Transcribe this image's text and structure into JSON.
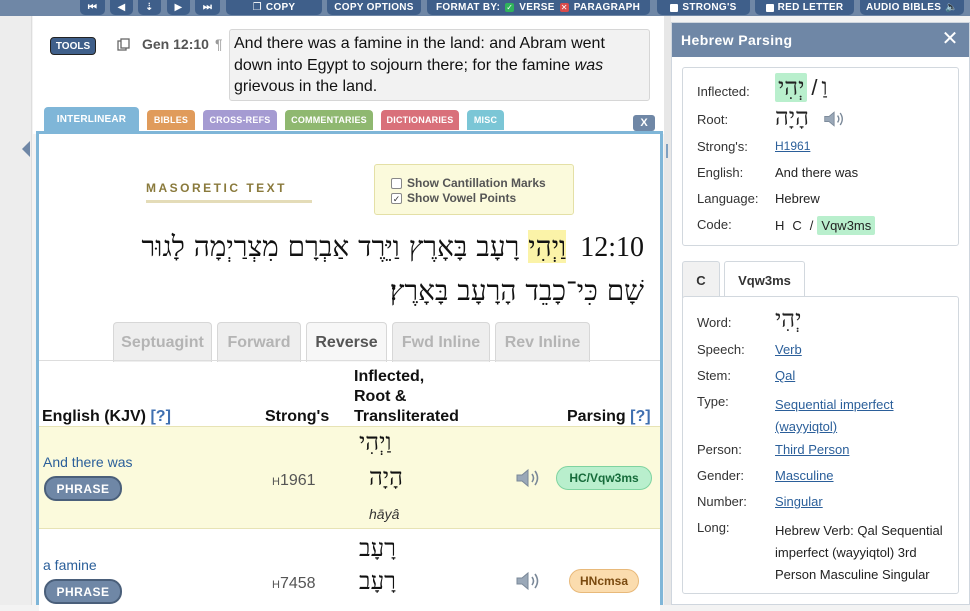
{
  "toolbar": {
    "copy_label": "COPY",
    "copy_options_label": "COPY OPTIONS",
    "format_by_label": "FORMAT BY:",
    "verse_label": "VERSE",
    "paragraph_label": "PARAGRAPH",
    "strongs_label": "STRONG'S",
    "red_letter_label": "RED LETTER",
    "audio_bibles_label": "AUDIO BIBLES",
    "icons": [
      "first-icon",
      "prev-icon",
      "down-icon",
      "next-icon",
      "last-icon",
      "speaker-icon"
    ]
  },
  "verse": {
    "tools_label": "TOOLS",
    "ref": "Gen 12:10",
    "pilcrow": "¶",
    "text_before": "And there was a famine in the land: and Abram went down into Egypt to sojourn there; for the famine ",
    "text_italic": "was",
    "text_after": " grievous in the land."
  },
  "tabs": {
    "interlinear": "INTERLINEAR",
    "bibles": "BIBLES",
    "cross_refs": "CROSS-REFS",
    "commentaries": "COMMENTARIES",
    "dictionaries": "DICTIONARIES",
    "misc": "MISC",
    "close": "X"
  },
  "tab_colors": {
    "interlinear": "#7fb6d8",
    "bibles": "#e09b5b",
    "cross_refs": "#a59bd2",
    "commentaries": "#8fb870",
    "dictionaries": "#d9707a",
    "misc": "#7bc6d6"
  },
  "masoretic": {
    "heading": "MASORETIC TEXT",
    "show_cantillation": "Show Cantillation Marks",
    "show_cantillation_checked": false,
    "show_vowels": "Show Vowel Points",
    "show_vowels_checked": true,
    "verse_number": "12:10",
    "first_word": "וַיְהִי",
    "line1_rest": "רָעָב בָּאָרֶץ וַיֵּרֶד אַבְרָם מִצְרַיְמָה לָגוּר",
    "line2": "שָׁם כִּי־כָבֵד הָרָעָב בָּאָרֶץ׃"
  },
  "views": {
    "septuagint": "Septuagint",
    "forward": "Forward",
    "reverse": "Reverse",
    "fwd_inline": "Fwd Inline",
    "rev_inline": "Rev Inline",
    "active": "reverse"
  },
  "interlinear": {
    "headers": {
      "english": "English (KJV)",
      "english_help": "[?]",
      "strongs": "Strong's",
      "inflected_l1": "Inflected,",
      "inflected_l2": "Root &",
      "inflected_l3": "Transliterated",
      "parsing": "Parsing",
      "parsing_help": "[?]"
    },
    "rows": [
      {
        "english": "And there was",
        "phrase": "PHRASE",
        "strongs_prefix": "H",
        "strongs_num": "1961",
        "inflected": "וַיְהִי",
        "root": "הָיָה",
        "translit": "hāyâ",
        "parsing": "HC/Vqw3ms",
        "badge_color": "#b9efcd"
      },
      {
        "english": "a famine",
        "phrase": "PHRASE",
        "strongs_prefix": "H",
        "strongs_num": "7458",
        "inflected": "רָעָב",
        "root": "רָעָב",
        "translit": "",
        "parsing": "HNcmsa",
        "badge_color": "#fbdcae"
      }
    ]
  },
  "parsing_panel": {
    "title": "Hebrew Parsing",
    "inflected_label": "Inflected:",
    "inflected_prefix": "וַ",
    "inflected_sep": "/",
    "inflected_word": "יְהִי",
    "root_label": "Root:",
    "root_value": "הָיָה",
    "strongs_label": "Strong's:",
    "strongs_value": "H1961",
    "english_label": "English:",
    "english_value": "And there was",
    "language_label": "Language:",
    "language_value": "Hebrew",
    "code_label": "Code:",
    "code_h": "H",
    "code_c": "C",
    "code_sep": "/",
    "code_badge": "Vqw3ms",
    "subtabs": {
      "c": "C",
      "vqw3ms": "Vqw3ms"
    },
    "word_label": "Word:",
    "word_value": "יְהִי",
    "speech_label": "Speech:",
    "speech_value": "Verb",
    "stem_label": "Stem:",
    "stem_value": "Qal",
    "type_label": "Type:",
    "type_value_l1": "Sequential imperfect",
    "type_value_l2": "(wayyiqtol)",
    "person_label": "Person:",
    "person_value": "Third Person",
    "gender_label": "Gender:",
    "gender_value": "Masculine",
    "number_label": "Number:",
    "number_value": "Singular",
    "long_label": "Long:",
    "long_value_l1": "Hebrew Verb: Qal Sequential",
    "long_value_l2": "imperfect (wayyiqtol) 3rd",
    "long_value_l3": "Person Masculine Singular"
  }
}
